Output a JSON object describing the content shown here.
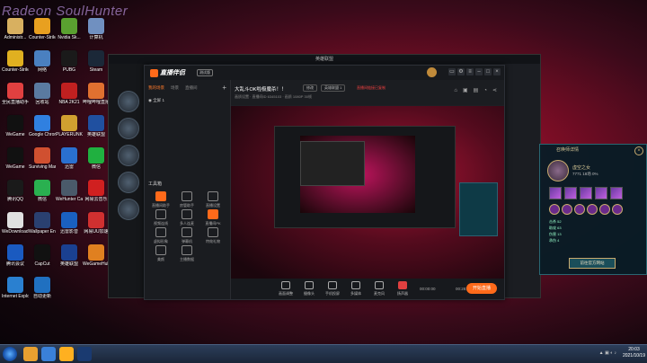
{
  "watermark": "Radeon SoulHunter",
  "desktop_icons": [
    {
      "label": "Administr...",
      "color": "#d8b060"
    },
    {
      "label": "Counter-Strike",
      "color": "#e8a020"
    },
    {
      "label": "Nvidia Sk...",
      "color": "#5aa030"
    },
    {
      "label": "计算机",
      "color": "#7090c0"
    },
    {
      "label": "Counter-Strike GO",
      "color": "#e0b020"
    },
    {
      "label": "网络",
      "color": "#4a80c0"
    },
    {
      "label": "PUBG",
      "color": "#1a1a1a"
    },
    {
      "label": "Steam",
      "color": "#1b2838"
    },
    {
      "label": "全民直播助手",
      "color": "#e04040"
    },
    {
      "label": "回收站",
      "color": "#5a7aa0"
    },
    {
      "label": "NBA 2K21",
      "color": "#c02020"
    },
    {
      "label": "哔哩哔哩直播",
      "color": "#e07030"
    },
    {
      "label": "WeGame",
      "color": "#111111"
    },
    {
      "label": "Google Chrome",
      "color": "#3080e0"
    },
    {
      "label": "PLAYERUNKNOWN'S BATTLEGROUNDS",
      "color": "#d0a030"
    },
    {
      "label": "英雄联盟",
      "color": "#2050a0"
    },
    {
      "label": "WeGame",
      "color": "#111111"
    },
    {
      "label": "Surviving Mars",
      "color": "#d05030"
    },
    {
      "label": "迅雷",
      "color": "#2a70d0"
    },
    {
      "label": "微信",
      "color": "#20b040"
    },
    {
      "label": "腾讯QQ",
      "color": "#1a1a1a"
    },
    {
      "label": "微信",
      "color": "#2ab050"
    },
    {
      "label": "WeHunter Call of...",
      "color": "#4a5a6a"
    },
    {
      "label": "网易云音乐",
      "color": "#d02020"
    },
    {
      "label": "WeDownload...",
      "color": "#e0e0e0"
    },
    {
      "label": "Wallpaper Engine",
      "color": "#2a4070"
    },
    {
      "label": "迅雷影音",
      "color": "#1a60c0"
    },
    {
      "label": "网易UU加速",
      "color": "#d03030"
    },
    {
      "label": "腾讯会议",
      "color": "#1a5ac0"
    },
    {
      "label": "CapCut",
      "color": "#111111"
    },
    {
      "label": "英雄联盟",
      "color": "#1a4090"
    },
    {
      "label": "WeGameHub",
      "color": "#e08020"
    },
    {
      "label": "Internet Explorer",
      "color": "#2a80d0"
    },
    {
      "label": "自动更新",
      "color": "#2070c0"
    }
  ],
  "mid_window": {
    "title": "英雄联盟"
  },
  "app": {
    "logo": "直播伴侣",
    "version": "测试版",
    "tabs": [
      "我的场景",
      "场景",
      "直播间"
    ],
    "source_item": "全屏 1",
    "tools_title": "工具箱",
    "tools": [
      "直播间助手",
      "房管助手",
      "直播设置",
      "视频连线",
      "多人连麦",
      "直播间PK",
      "虚拟形象",
      "弹幕机",
      "特效礼物",
      "美颜",
      "主播数据"
    ],
    "header_title": "大乱斗OK啦极魔杀！！",
    "header_btn1": "修改",
    "header_btn2": "英雄联盟 1",
    "header_red": "直播间链接已复制",
    "header_sub": "画质设置 · 直播间ID 6345103 · 画质 1080P 30帧",
    "bottom_buttons": [
      "画面调整",
      "摄像头",
      "手机投屏",
      "多媒体",
      "麦克风",
      "扬声器"
    ],
    "go_live": "开始直播",
    "timer_left": "00:00:00",
    "timer_right": "00:28:51"
  },
  "panel": {
    "title": "召唤师详情",
    "name": "虚空之女",
    "nums": "7771  18场  0%",
    "stats": [
      "击杀 52",
      "助攻 63",
      "伤害 13",
      "承伤 4"
    ],
    "button": "前往官方网站"
  },
  "taskbar": {
    "time": "20:03",
    "date": "2021/10/19"
  }
}
